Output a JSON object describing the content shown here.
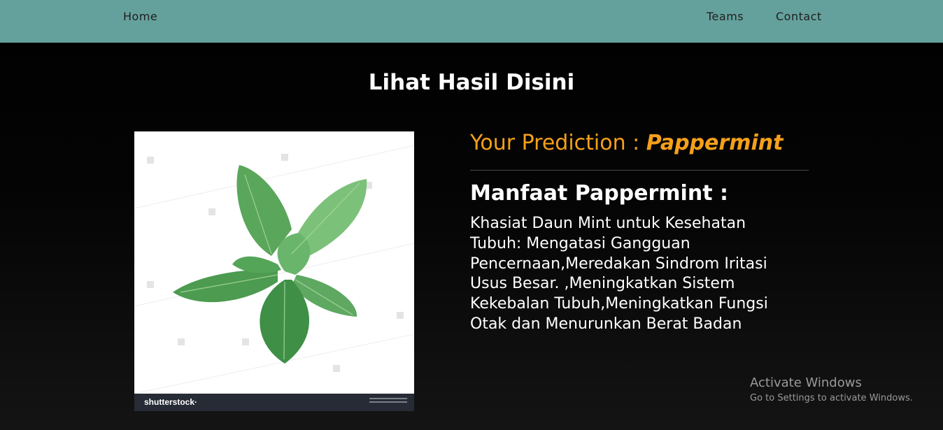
{
  "nav": {
    "home": "Home",
    "teams": "Teams",
    "contact": "Contact",
    "background_color": "#65a19c"
  },
  "page": {
    "title": "Lihat Hasil Disini"
  },
  "result": {
    "image_alt": "peppermint leaves",
    "stock_logo_text": "shutterstock·",
    "prediction_label": "Your Prediction : ",
    "prediction_value": "Pappermint",
    "prediction_color": "#f5a01a",
    "benefit_title": "Manfaat Pappermint :",
    "benefit_text": "Khasiat Daun Mint untuk Kesehatan Tubuh: Mengatasi Gangguan Pencernaan,Meredakan Sindrom Iritasi Usus Besar. ,Meningkatkan Sistem Kekebalan Tubuh,Meningkatkan Fungsi Otak dan Menurunkan Berat Badan"
  },
  "watermark": {
    "title": "Activate Windows",
    "subtitle": "Go to Settings to activate Windows."
  }
}
